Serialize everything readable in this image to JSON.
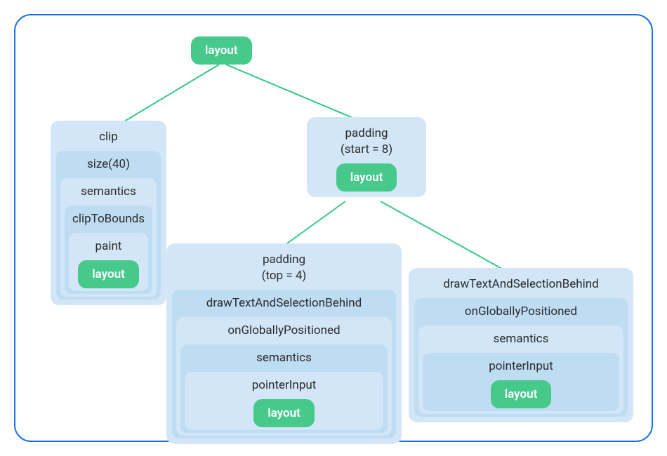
{
  "diagram": {
    "root": {
      "label": "layout"
    },
    "left": {
      "modifiers": [
        "clip",
        "size(40)",
        "semantics",
        "clipToBounds",
        "paint"
      ],
      "terminal": "layout"
    },
    "mid": {
      "header": "padding\n(start = 8)",
      "terminal": "layout"
    },
    "leafL": {
      "header": "padding\n(top = 4)",
      "modifiers": [
        "drawTextAndSelectionBehind",
        "onGloballyPositioned",
        "semantics",
        "pointerInput"
      ],
      "terminal": "layout"
    },
    "leafR": {
      "modifiers": [
        "drawTextAndSelectionBehind",
        "onGloballyPositioned",
        "semantics",
        "pointerInput"
      ],
      "terminal": "layout"
    }
  },
  "colors": {
    "frameBorder": "#1a73e8",
    "nodeLight": "#d2e6f7",
    "nodeDark": "#bedcf2",
    "chip": "#46c98b",
    "edge": "#34c986"
  }
}
